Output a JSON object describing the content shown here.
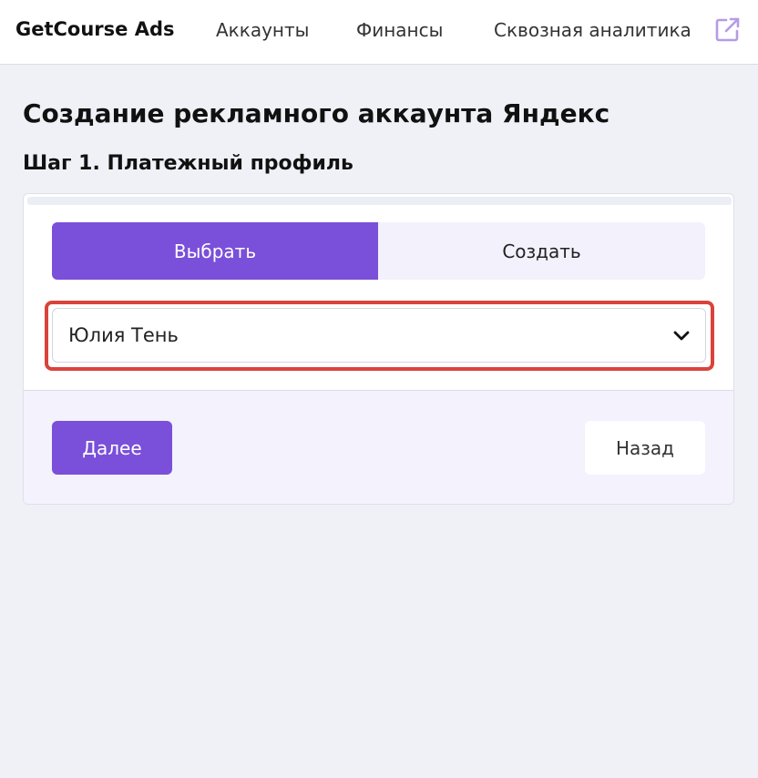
{
  "header": {
    "brand": "GetCourse Ads",
    "nav": {
      "accounts": "Аккаунты",
      "finance": "Финансы",
      "analytics": "Сквозная аналитика"
    },
    "external_icon": "external-link-icon"
  },
  "page": {
    "title": "Создание рекламного аккаунта Яндекс",
    "step_title": "Шаг 1. Платежный профиль"
  },
  "tabs": {
    "select": "Выбрать",
    "create": "Создать",
    "active": "select"
  },
  "profile_select": {
    "value": "Юлия Тень",
    "icon": "chevron-down-icon"
  },
  "footer": {
    "next_label": "Далее",
    "back_label": "Назад"
  },
  "colors": {
    "accent": "#7a4fd9",
    "highlight": "#d9433b",
    "background": "#eff1f6"
  }
}
